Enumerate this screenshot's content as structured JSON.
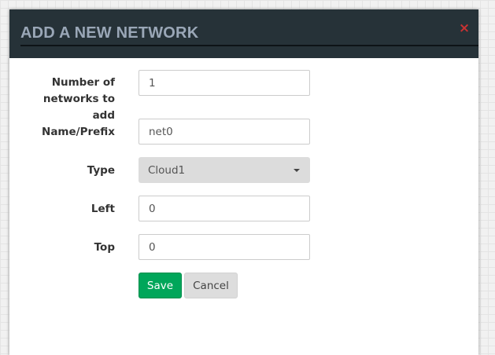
{
  "modal": {
    "title": "ADD A NEW NETWORK",
    "close_glyph": "×"
  },
  "form": {
    "count_label_line1": "Number of",
    "count_label_line2": "networks to add",
    "count_value": "1",
    "name_label": "Name/Prefix",
    "name_value": "net0",
    "type_label": "Type",
    "type_selected": "Cloud1",
    "left_label": "Left",
    "left_value": "0",
    "top_label": "Top",
    "top_value": "0"
  },
  "buttons": {
    "save_label": "Save",
    "cancel_label": "Cancel"
  },
  "colors": {
    "header_bg": "#263238",
    "title_text": "#9aa7b7",
    "close_icon": "#c83232",
    "save_bg": "#00a65a",
    "cancel_bg": "#dddddd"
  },
  "icons": {
    "close": "close-icon",
    "dropdown": "chevron-down-icon"
  }
}
